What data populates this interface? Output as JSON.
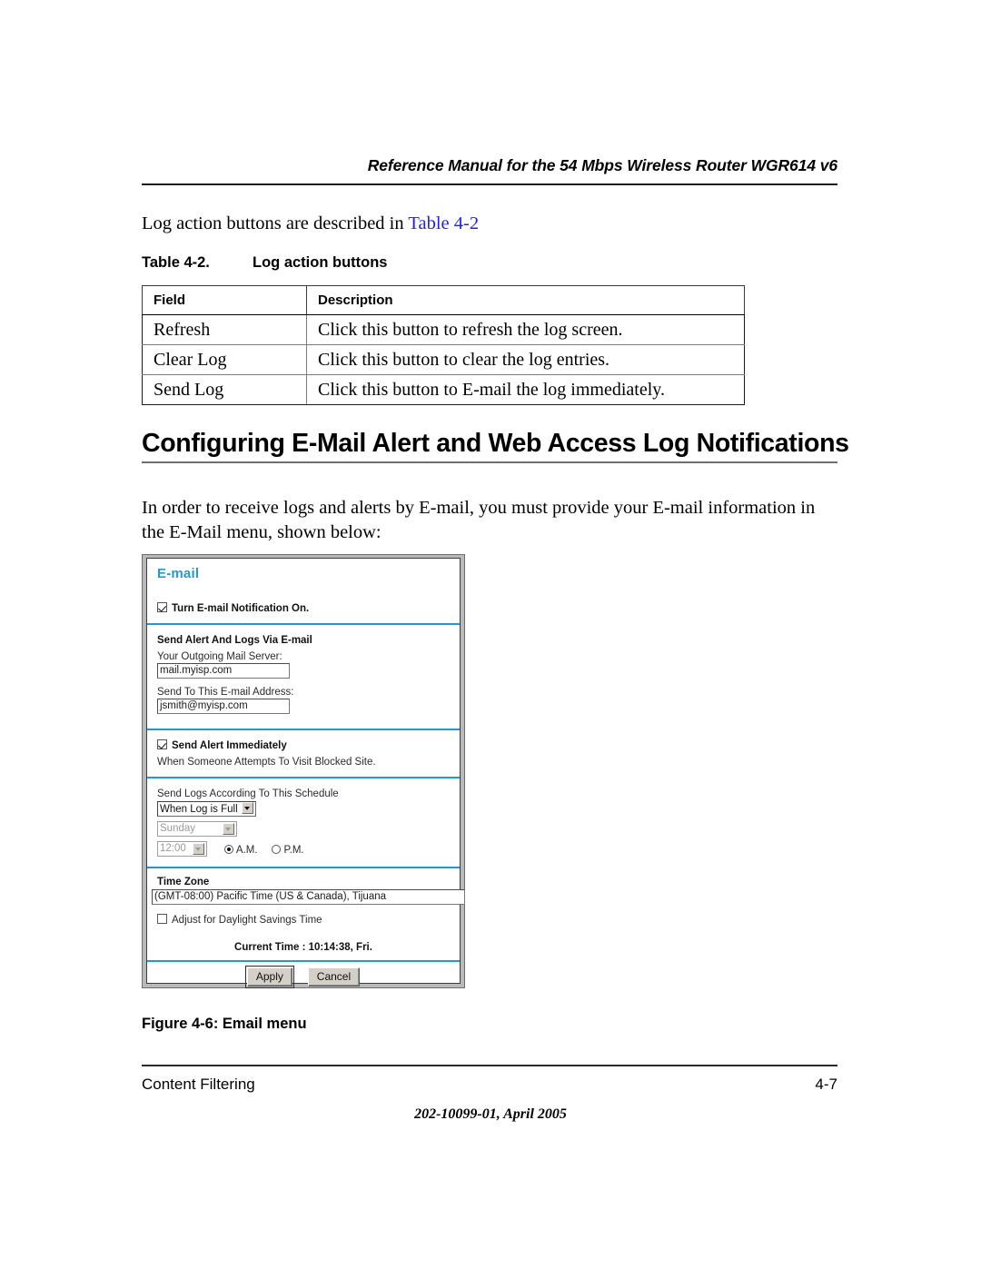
{
  "header": {
    "running_title": "Reference Manual for the 54 Mbps Wireless Router WGR614 v6"
  },
  "intro": {
    "text_before": "Log action buttons are described in ",
    "link_text": "Table 4-2",
    "link_color": "#2222dd"
  },
  "table": {
    "caption_number": "Table 4-2.",
    "caption_title": "Log action buttons",
    "columns": [
      "Field",
      "Description"
    ],
    "rows": [
      [
        "Refresh",
        "Click this button to refresh the log screen."
      ],
      [
        "Clear Log",
        "Click this button to clear the log entries."
      ],
      [
        "Send Log",
        "Click this button to E-mail the log immediately."
      ]
    ]
  },
  "section": {
    "heading": "Configuring E-Mail Alert and Web Access Log Notifications",
    "paragraph": "In order to receive logs and alerts by E-mail, you must provide your E-mail information in the E-Mail menu, shown below:"
  },
  "figure": {
    "panel_title": "E-mail",
    "accent_color": "#2699c9",
    "notification": {
      "checkbox_checked": true,
      "label": "Turn E-mail Notification On."
    },
    "send_alert_section": {
      "heading": "Send Alert And Logs Via E-mail",
      "mail_server_label": "Your Outgoing Mail Server:",
      "mail_server_value": "mail.myisp.com",
      "email_address_label": "Send To This E-mail Address:",
      "email_address_value": "jsmith@myisp.com"
    },
    "alert_immediately": {
      "checkbox_checked": true,
      "label": "Send Alert Immediately",
      "sublabel": "When Someone Attempts To Visit Blocked Site."
    },
    "schedule": {
      "heading": "Send Logs According To This Schedule",
      "frequency_value": "When Log is Full",
      "day_value": "Sunday",
      "day_disabled": true,
      "time_value": "12:00",
      "time_disabled": true,
      "am_label": "A.M.",
      "pm_label": "P.M.",
      "am_selected": true,
      "pm_selected": false
    },
    "time_zone": {
      "heading": "Time Zone",
      "value": "(GMT-08:00) Pacific Time (US & Canada), Tijuana",
      "dst_checkbox_checked": false,
      "dst_label": "Adjust for Daylight Savings Time",
      "current_time": "Current Time : 10:14:38, Fri."
    },
    "buttons": {
      "apply": "Apply",
      "cancel": "Cancel"
    },
    "caption": "Figure 4-6:  Email menu"
  },
  "footer": {
    "left": "Content Filtering",
    "right": "4-7",
    "center": "202-10099-01, April 2005"
  }
}
